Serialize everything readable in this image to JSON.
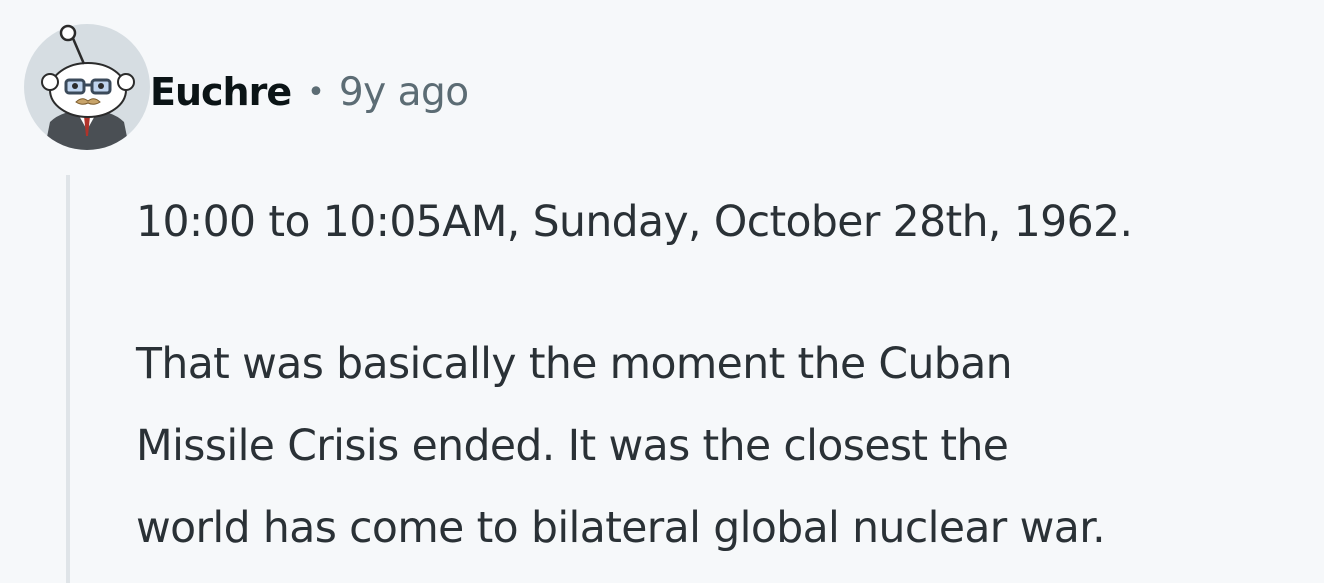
{
  "comment": {
    "author": "Euchre",
    "separator": "•",
    "time_ago": "9y ago",
    "avatar_icon": "snoo-avatar-icon",
    "body": {
      "line1": "10:00 to 10:05AM, Sunday, October 28th, 1962.",
      "line2": "That was basically the moment the Cuban",
      "line3": "Missile Crisis ended. It was the closest the",
      "line4": "world has come to bilateral global nuclear war."
    }
  },
  "colors": {
    "background": "#f6f8fa",
    "username": "#0b1416",
    "meta": "#5c6c74",
    "body_text": "#2a3136",
    "thread_line": "#dfe4e8"
  }
}
